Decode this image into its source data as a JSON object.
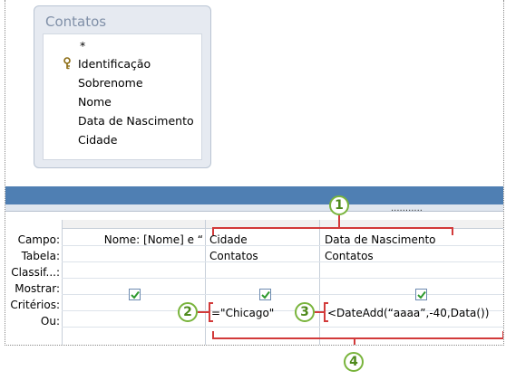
{
  "table_box": {
    "title": "Contatos",
    "fields": [
      {
        "label": "*",
        "key": false
      },
      {
        "label": "Identificação",
        "key": true
      },
      {
        "label": "Sobrenome",
        "key": false
      },
      {
        "label": "Nome",
        "key": false
      },
      {
        "label": "Data de Nascimento",
        "key": false
      },
      {
        "label": "Cidade",
        "key": false
      }
    ]
  },
  "grid": {
    "row_labels": {
      "campo": "Campo:",
      "tabela": "Tabela:",
      "classif": "Classif...:",
      "mostrar": "Mostrar:",
      "criterios": "Critérios:",
      "ou": "Ou:"
    },
    "columns": [
      {
        "campo": "Nome: [Nome] e “",
        "tabela": "",
        "mostrar": true,
        "criterios": ""
      },
      {
        "campo": "Cidade",
        "tabela": "Contatos",
        "mostrar": true,
        "criterios": "=\"Chicago\""
      },
      {
        "campo": "Data de Nascimento",
        "tabela": "Contatos",
        "mostrar": true,
        "criterios": "<DateAdd(“aaaa”,-40,Data())"
      }
    ],
    "divider_dots": "..........."
  },
  "callouts": [
    "1",
    "2",
    "3",
    "4"
  ],
  "colors": {
    "band": "#4f7fb3",
    "callout_green": "#79b43c",
    "bracket_red": "#d23a3a",
    "check_green": "#2e9a2e"
  }
}
